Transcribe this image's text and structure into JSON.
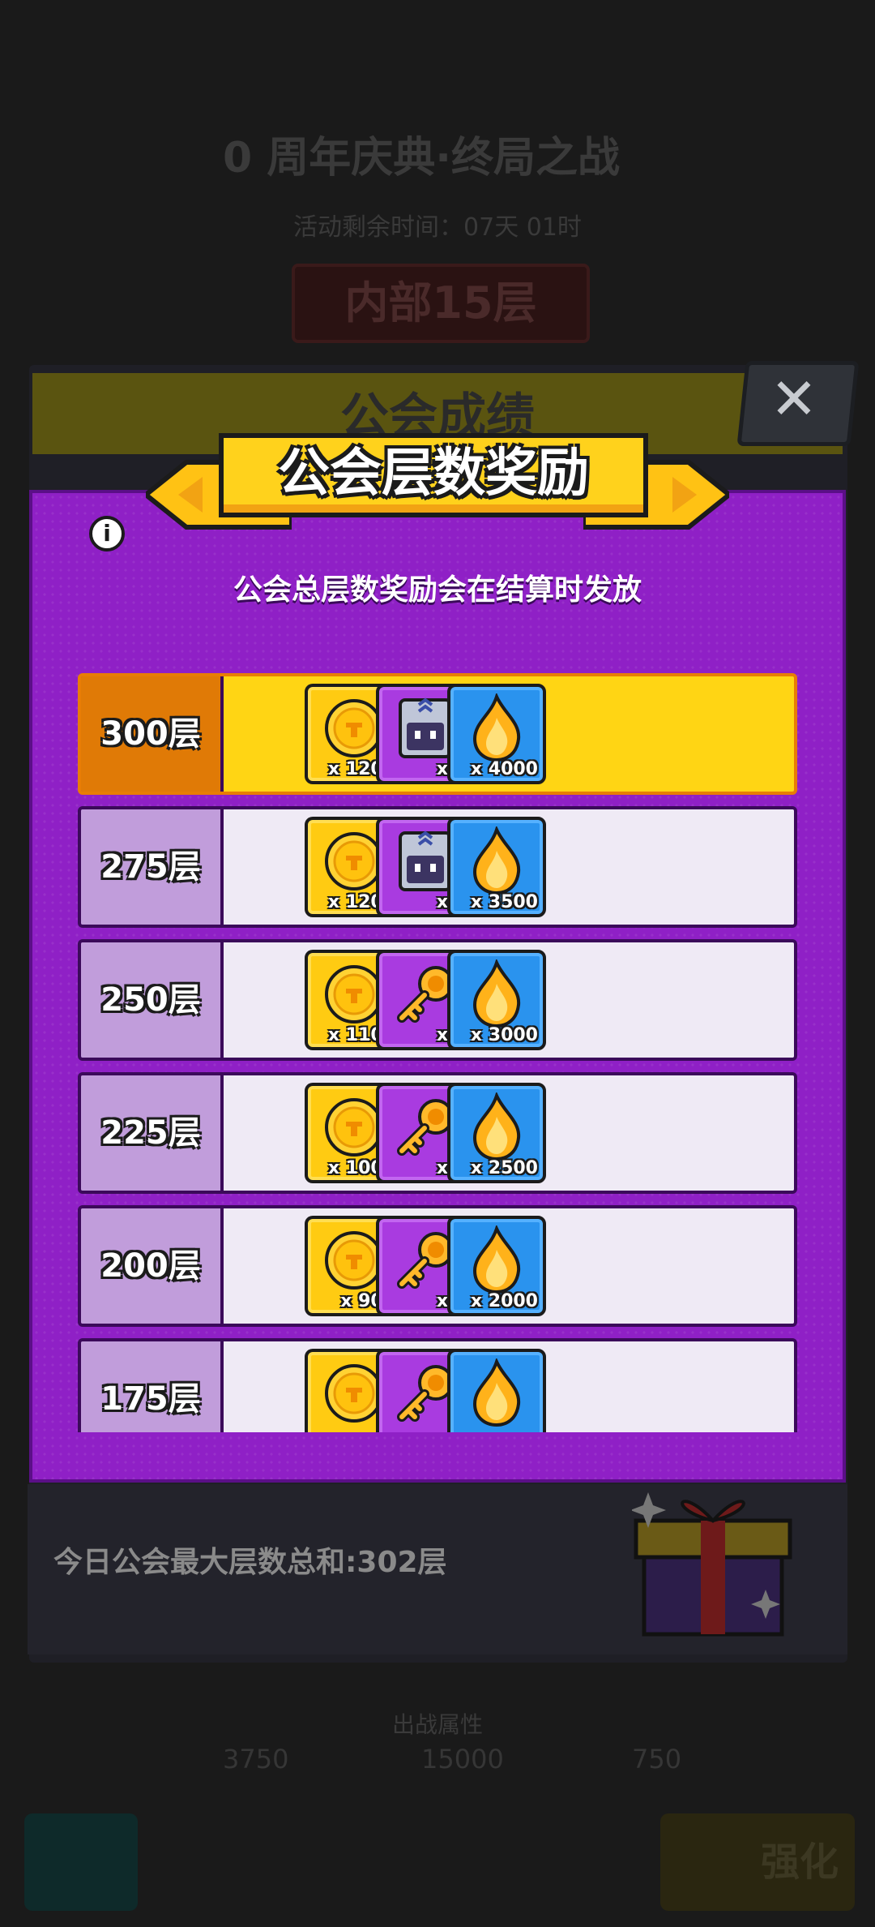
{
  "background": {
    "event_title": "0 周年庆典·终局之战",
    "timer": "活动剩余时间：07天 01时",
    "floor_label": "内部15层",
    "panel_title": "公会成绩",
    "attr_label": "出战属性",
    "stats": [
      "3750",
      "15000",
      "750"
    ],
    "upgrade_label": "强化"
  },
  "modal": {
    "title": "公会层数奖励",
    "info_icon": "i",
    "subtitle": "公会总层数奖励会在结算时发放",
    "close_icon": "✕",
    "rows": [
      {
        "label": "300层",
        "items": [
          {
            "type": "coin",
            "qty": "x 1200"
          },
          {
            "type": "chest",
            "qty": "x 1"
          },
          {
            "type": "flame",
            "qty": "x 4000"
          }
        ]
      },
      {
        "label": "275层",
        "items": [
          {
            "type": "coin",
            "qty": "x 1200"
          },
          {
            "type": "chest",
            "qty": "x 1"
          },
          {
            "type": "flame",
            "qty": "x 3500"
          }
        ]
      },
      {
        "label": "250层",
        "items": [
          {
            "type": "coin",
            "qty": "x 1100"
          },
          {
            "type": "key",
            "qty": "x 4"
          },
          {
            "type": "flame",
            "qty": "x 3000"
          }
        ]
      },
      {
        "label": "225层",
        "items": [
          {
            "type": "coin",
            "qty": "x 1000"
          },
          {
            "type": "key",
            "qty": "x 4"
          },
          {
            "type": "flame",
            "qty": "x 2500"
          }
        ]
      },
      {
        "label": "200层",
        "items": [
          {
            "type": "coin",
            "qty": "x 900"
          },
          {
            "type": "key",
            "qty": "x 3"
          },
          {
            "type": "flame",
            "qty": "x 2000"
          }
        ]
      },
      {
        "label": "175层",
        "items": [
          {
            "type": "coin",
            "qty": ""
          },
          {
            "type": "key",
            "qty": ""
          },
          {
            "type": "flame",
            "qty": ""
          }
        ]
      }
    ]
  },
  "summary": {
    "text": "今日公会最大层数总和:302层",
    "gift_icon": "gift-icon"
  },
  "colors": {
    "modal_purple": "#8f20c6",
    "banner_yellow": "#ffd21c",
    "highlight_row": "#ffd514",
    "highlight_label": "#e07a06",
    "row_label": "#c19ddb"
  }
}
